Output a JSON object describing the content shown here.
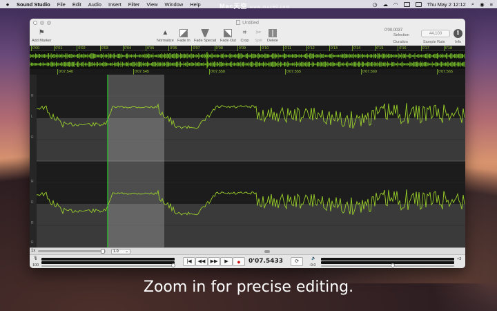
{
  "menubar": {
    "app_name": "Sound Studio",
    "items": [
      "File",
      "Edit",
      "Audio",
      "Insert",
      "Filter",
      "View",
      "Window",
      "Help"
    ],
    "clock": "Thu May 2  12:12"
  },
  "watermark": {
    "text": "Mac天空",
    "sub": "www.mac69.com"
  },
  "window": {
    "title": "Untitled",
    "toolbar": {
      "add_marker": "Add Marker",
      "normalize": "Normalize",
      "fade_in": "Fade In",
      "fade_special": "Fade Special",
      "fade_out": "Fade Out",
      "crop": "Crop",
      "split": "Split",
      "delete": "Delete",
      "duration_value": "0'00.0037",
      "selection_label": "Selection",
      "duration_label": "Duration",
      "sample_rate_value": "44,100",
      "sample_rate_label": "Sample Rate",
      "info_label": "Info"
    },
    "overview_ruler": [
      "0'00",
      "0'01",
      "0'02",
      "0'03",
      "0'04",
      "0'05",
      "0'06",
      "0'07",
      "0'08",
      "0'09",
      "0'10",
      "0'11",
      "0'12",
      "0'13",
      "0'14",
      "0'15",
      "0'16",
      "0'17",
      "0'18"
    ],
    "detail_ruler": [
      "0'07.540",
      "0'07.545",
      "0'07.550",
      "0'07.555",
      "0'07.560",
      "0'07.565"
    ],
    "channel_labels": [
      "R",
      "L",
      "R",
      "R",
      "R",
      "R",
      "R"
    ],
    "zoom": {
      "level_label": "1x",
      "select_value": "1.0"
    },
    "transport": {
      "input_level": "100",
      "time": "0'07.5433",
      "output_level": "-9.0",
      "right_value": "+3"
    }
  },
  "caption": "Zoom in for precise editing."
}
